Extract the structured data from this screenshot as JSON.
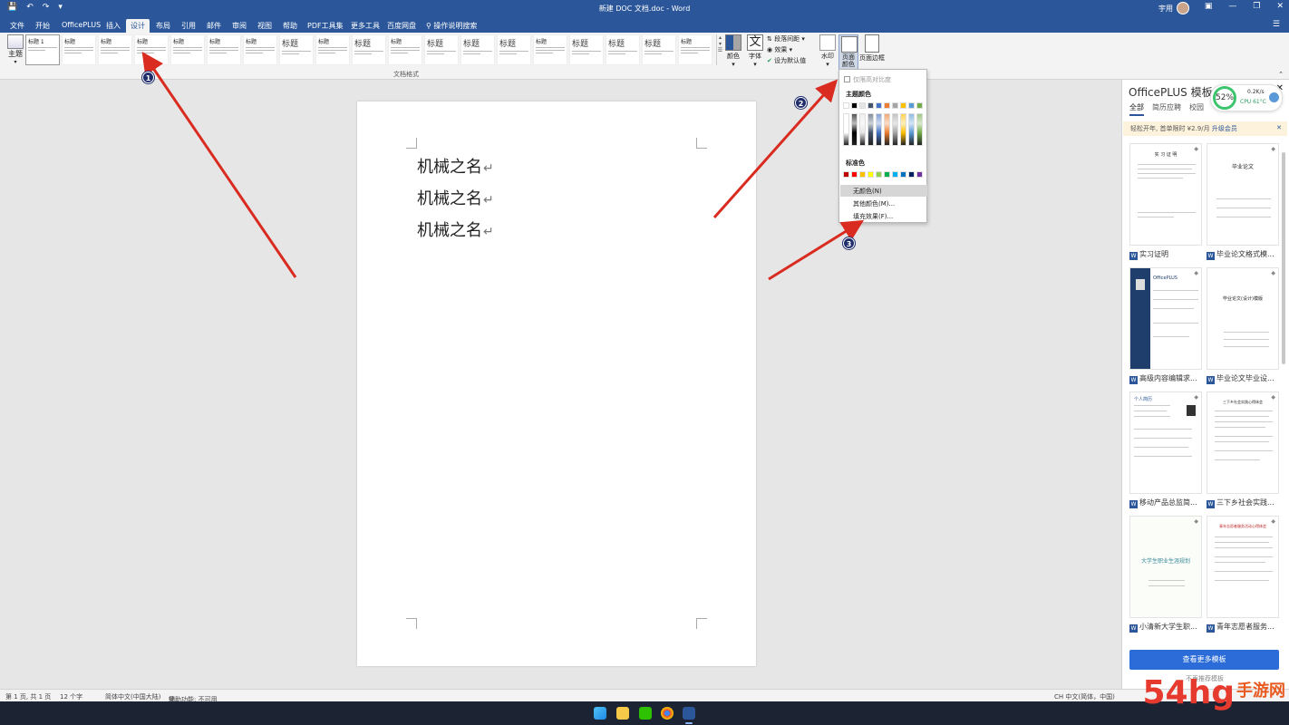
{
  "titlebar": {
    "doc_title": "新建 DOC 文档.doc - Word",
    "user": "宇用",
    "qat_icons": [
      "save-icon",
      "undo-icon",
      "redo-icon",
      "customize-icon"
    ],
    "window_controls": [
      "ribbon-display-icon",
      "minimize-icon",
      "restore-icon",
      "close-icon"
    ]
  },
  "tabs": [
    "文件",
    "开始",
    "OfficePLUS",
    "插入",
    "设计",
    "布局",
    "引用",
    "邮件",
    "审阅",
    "视图",
    "帮助",
    "PDF工具集",
    "更多工具",
    "百度网盘"
  ],
  "active_tab": "设计",
  "tell_me": "操作说明搜索",
  "ribbon": {
    "theme_label": "主题",
    "style_heading": "标题",
    "style_heading_first": "标题 1",
    "gallery_group_label": "文档格式",
    "colors_label": "颜色",
    "fonts_label": "字体",
    "fonts_glyph": "文",
    "paragraph_spacing": "段落间距",
    "effects": "效果",
    "set_default": "设为默认值",
    "watermark": "水印",
    "page_color": "页面颜色",
    "page_borders": "页面边框"
  },
  "document": {
    "lines": [
      "机械之名",
      "机械之名",
      "机械之名"
    ],
    "para_mark": "↵"
  },
  "page_color_menu": {
    "compat_note": "仅限高对比度",
    "theme_colors_label": "主题颜色",
    "theme_colors": [
      "#ffffff",
      "#000000",
      "#e7e6e6",
      "#44546a",
      "#4472c4",
      "#ed7d31",
      "#a5a5a5",
      "#ffc000",
      "#5b9bd5",
      "#70ad47"
    ],
    "standard_colors_label": "标准色",
    "standard_colors": [
      "#c00000",
      "#ff0000",
      "#ffc000",
      "#ffff00",
      "#92d050",
      "#00b050",
      "#00b0f0",
      "#0070c0",
      "#002060",
      "#7030a0"
    ],
    "no_color": "无颜色(N)",
    "more_colors": "其他颜色(M)...",
    "fill_effects": "填充效果(F)..."
  },
  "steps": [
    "1",
    "2",
    "3"
  ],
  "panel": {
    "title": "OfficePLUS 模板",
    "tabs": [
      "全部",
      "简历应聘",
      "校园"
    ],
    "promo": "轻松开年, 首单限时 ¥2.9/月",
    "promo_link": "升级会员",
    "perf_percent": "52%",
    "perf_speed": "0.2K/s",
    "perf_cpu": "CPU 61°C",
    "templates": [
      {
        "name": "实习证明",
        "text": "实 习 证 明"
      },
      {
        "name": "毕业论文格式模...",
        "text": "毕业论文"
      },
      {
        "name": "高级内容编辑求...",
        "text": "OfficePLUS"
      },
      {
        "name": "毕业论文毕业设...",
        "text": "毕业论文(设计)模版"
      },
      {
        "name": "移动产品总监简...",
        "text": "个人简历"
      },
      {
        "name": "三下乡社会实践...",
        "text": "三下乡社会实践心得体会"
      },
      {
        "name": "小清新大学生职...",
        "text": "大学生职业生涯规划"
      },
      {
        "name": "青年志愿者服务...",
        "text": "青年志愿者服务活动心得体会"
      }
    ],
    "more_button": "查看更多模板",
    "no_remind": "不再推荐模板"
  },
  "statusbar": {
    "page": "第 1 页, 共 1 页",
    "words": "12 个字",
    "language": "简体中文(中国大陆)",
    "accessibility": "辅助功能: 不可用",
    "ime": "CH 中文(简体，中国)"
  },
  "watermark": {
    "main": "54hg",
    "sub": "手游网"
  }
}
